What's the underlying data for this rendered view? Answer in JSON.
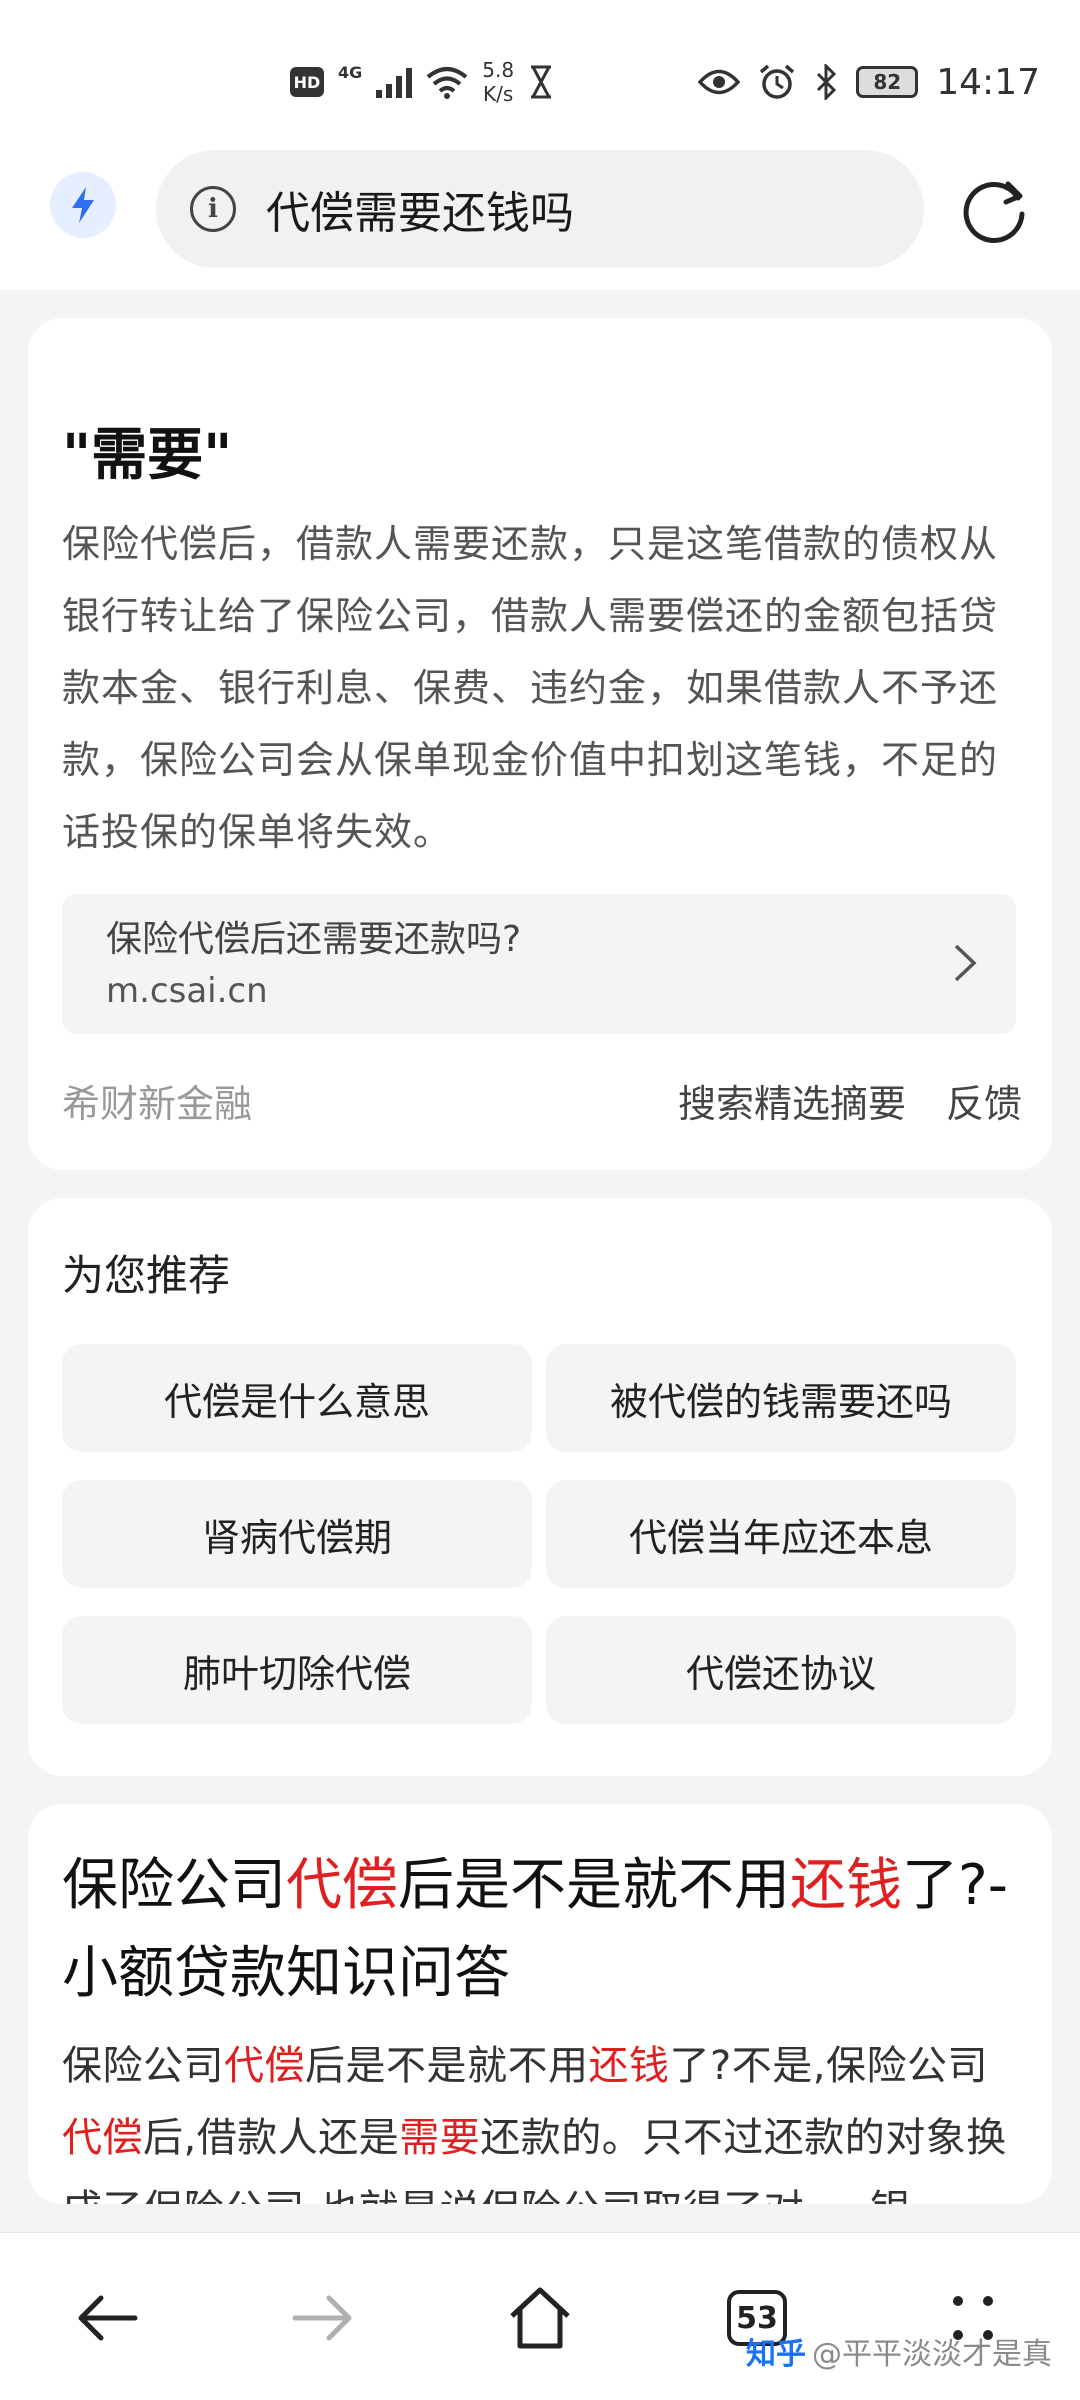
{
  "status_bar": {
    "hd": "HD",
    "net": "4G",
    "speed_value": "5.8",
    "speed_unit": "K/s",
    "battery": "82",
    "time": "14:17"
  },
  "address_bar": {
    "query": "代偿需要还钱吗"
  },
  "answer_card": {
    "title": "\"需要\"",
    "body": "保险代偿后，借款人需要还款，只是这笔借款的债权从银行转让给了保险公司，借款人需要偿还的金额包括贷款本金、银行利息、保费、违约金，如果借款人不予还款，保险公司会从保单现金价值中扣划这笔钱，不足的话投保的保单将失效。",
    "source_title": "保险代偿后还需要还款吗?",
    "source_domain": "m.csai.cn",
    "source_name": "希财新金融",
    "label": "搜索精选摘要",
    "feedback": "反馈"
  },
  "recommend": {
    "title": "为您推荐",
    "items": [
      "代偿是什么意思",
      "被代偿的钱需要还吗",
      "肾病代偿期",
      "代偿当年应还本息",
      "肺叶切除代偿",
      "代偿还协议"
    ]
  },
  "result": {
    "title_parts": [
      "保险公司",
      "代偿",
      "后是不是就不用",
      "还钱",
      "了?-小额贷款知识问答"
    ],
    "body_parts": [
      "保险公司",
      "代偿",
      "后是不是就不用",
      "还钱",
      "了?不是,保险公司",
      "代偿",
      "后,借款人还是",
      "需要",
      "还款的。只不过还款的对象换成了保险公司,也就是说保险公司取得了对.... 银..."
    ]
  },
  "bottom_nav": {
    "tab_count": "53",
    "watermark_logo": "知乎",
    "watermark_text": "@平平淡淡才是真"
  },
  "colors": {
    "highlight": "#e02020",
    "accent": "#1772f6"
  }
}
